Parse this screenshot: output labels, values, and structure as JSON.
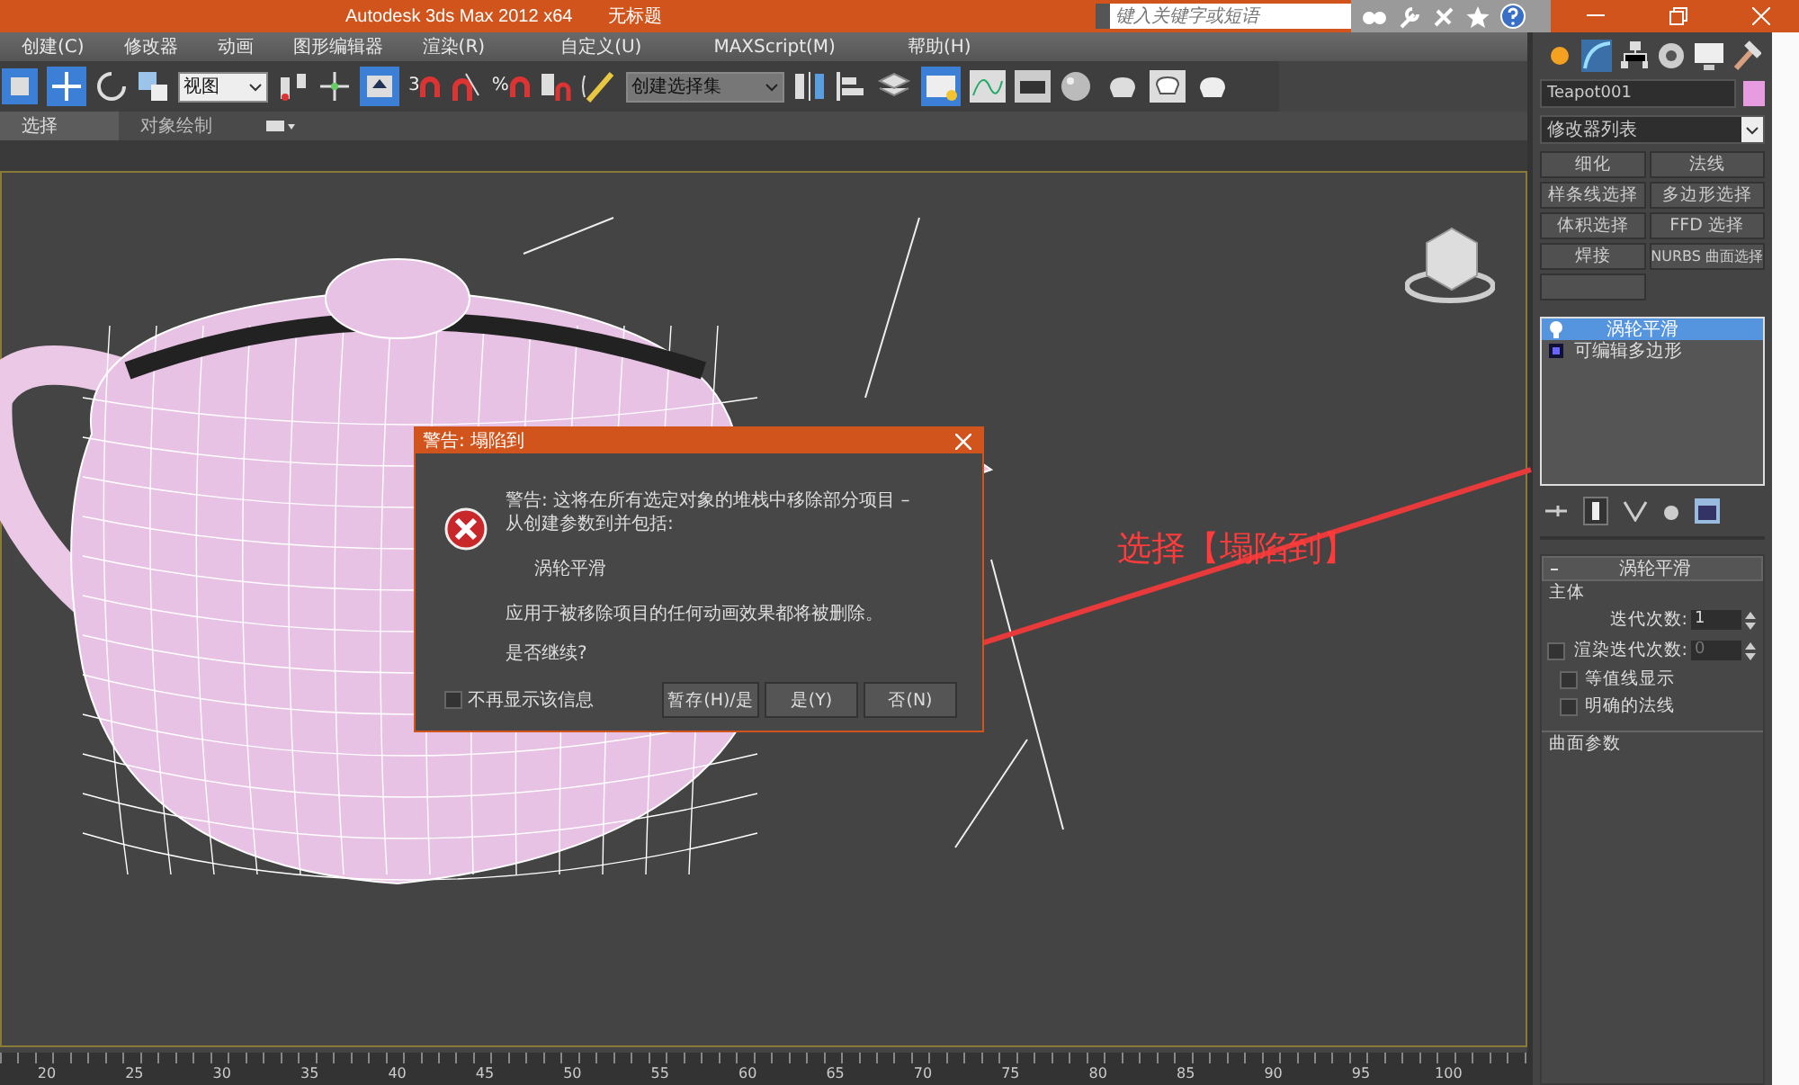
{
  "window": {
    "title": "Autodesk 3ds Max  2012 x64",
    "document": "无标题",
    "search_placeholder": "键入关键字或短语"
  },
  "menu": [
    "创建(C)",
    "修改器",
    "动画",
    "图形编辑器",
    "渲染(R)",
    "自定义(U)",
    "MAXScript(M)",
    "帮助(H)"
  ],
  "toolbar": {
    "view_dropdown": "视图",
    "snap_label": "3",
    "percent_label": "%",
    "selection_set": "创建选择集"
  },
  "ribbon_tabs": [
    {
      "label": "选择",
      "selected": true
    },
    {
      "label": "对象绘制",
      "selected": false
    }
  ],
  "command_panel": {
    "object_name": "Teapot001",
    "modifier_list": "修改器列表",
    "modifier_buttons": [
      "细化",
      "法线",
      "样条线选择",
      "多边形选择",
      "体积选择",
      "FFD 选择",
      "焊接",
      "NURBS 曲面选择"
    ],
    "stack": [
      {
        "label": "涡轮平滑",
        "selected": true
      },
      {
        "label": "可编辑多边形",
        "selected": false
      }
    ],
    "rollout_title": "涡轮平滑",
    "group_main": "主体",
    "iterations": {
      "label": "迭代次数:",
      "value": "1"
    },
    "render_iterations": {
      "label": "渲染迭代次数:",
      "value": "0",
      "checked": false
    },
    "options": [
      {
        "label": "等值线显示",
        "checked": false
      },
      {
        "label": "明确的法线",
        "checked": false
      }
    ],
    "group_surface": "曲面参数"
  },
  "dialog": {
    "title": "警告: 塌陷到",
    "message": "警告: 这将在所有选定对象的堆栈中移除部分项目 – 从创建参数到并包括:",
    "item": "涡轮平滑",
    "note": "应用于被移除项目的任何动画效果都将被删除。",
    "question": "是否继续?",
    "dont_show": {
      "label": "不再显示该信息",
      "checked": false
    },
    "buttons": [
      {
        "label": "暂存(H)/是",
        "selected": false
      },
      {
        "label": "是(Y)",
        "selected": false
      },
      {
        "label": "否(N)",
        "selected": false
      }
    ]
  },
  "annotation": "选择【塌陷到】",
  "timeline": [
    "20",
    "25",
    "30",
    "35",
    "40",
    "45",
    "50",
    "55",
    "60",
    "65",
    "70",
    "75",
    "80",
    "85",
    "90",
    "95",
    "100"
  ]
}
